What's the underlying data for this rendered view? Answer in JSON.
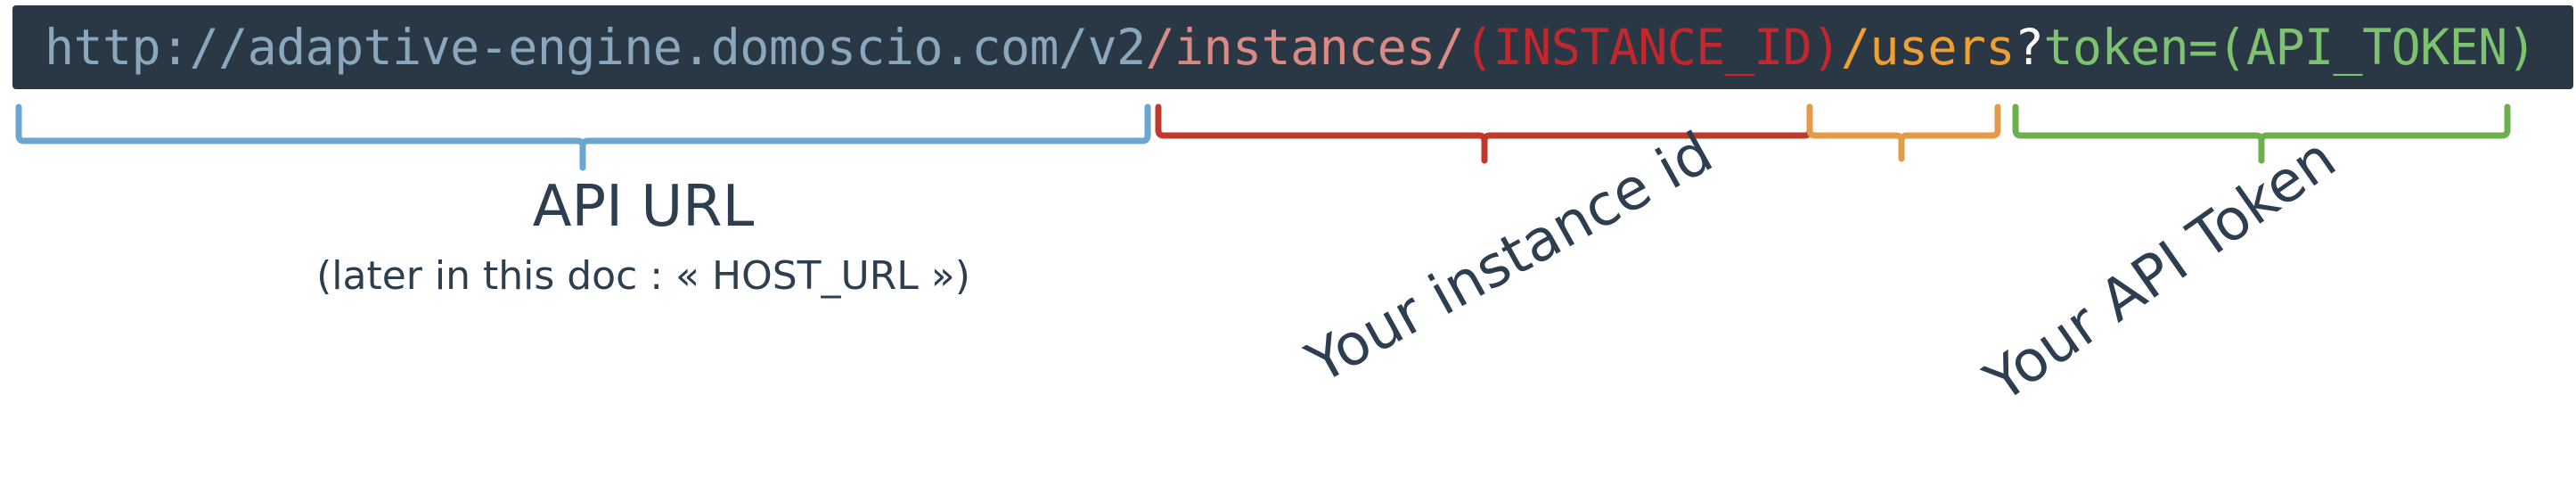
{
  "url": {
    "base": "http://adaptive-engine.domoscio.com/v2",
    "instances_path": "/instances/",
    "instance_id": "(INSTANCE_ID)",
    "users_path": "/users",
    "query_mark": "?",
    "token_key": "token=",
    "token_value": "(API_TOKEN)"
  },
  "labels": {
    "api_url": "API URL",
    "api_url_sub": "(later in this doc : « HOST_URL »)",
    "instance": "Your instance id",
    "token": "Your API Token"
  },
  "colors": {
    "bar_background": "#2a3744",
    "base": "#8aa7bd",
    "instances_path": "#d98a84",
    "instance_id": "#c1272d",
    "users_path": "#f0a030",
    "query_mark": "#ffffff",
    "token": "#7cc26f",
    "bracket_blue": "#6aa6cf",
    "bracket_red": "#c0392b",
    "bracket_orange": "#e39b4a",
    "bracket_green": "#6ab04c",
    "text": "#2c3e50"
  }
}
